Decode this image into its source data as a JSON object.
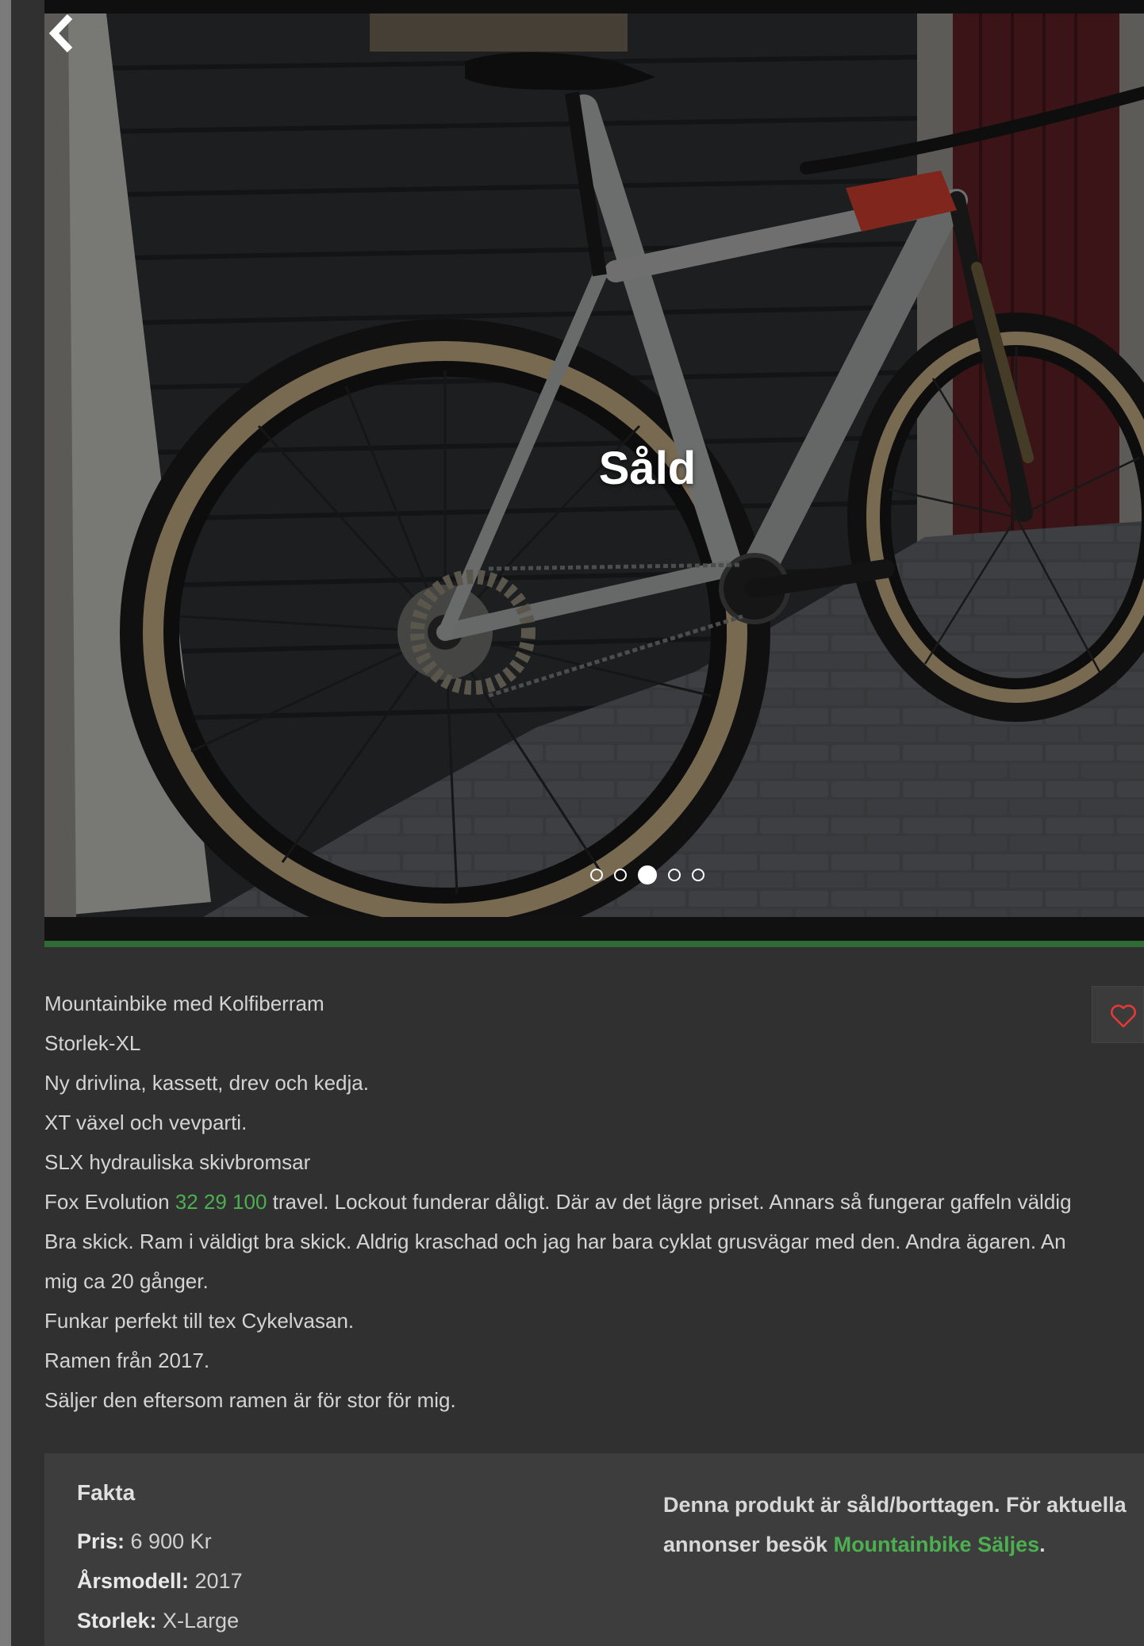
{
  "hero": {
    "overlay_label": "Såld",
    "dots": [
      false,
      false,
      true,
      false,
      false
    ],
    "next_icon": "chevron-right-icon"
  },
  "description": {
    "lines": [
      "Mountainbike med Kolfiberram",
      "Storlek-XL",
      "Ny drivlina, kassett, drev och kedja.",
      "XT växel och vevparti.",
      "SLX hydrauliska skivbromsar"
    ],
    "fox_prefix": "Fox Evolution ",
    "fox_link": "32 29 100",
    "fox_suffix": " travel. Lockout funderar dåligt. Där av det lägre priset. Annars så fungerar gaffeln väldig",
    "lines_after": [
      "Bra skick. Ram i väldigt bra skick. Aldrig kraschad och jag har bara cyklat grusvägar med den. Andra ägaren. An",
      "mig ca 20 gånger.",
      "Funkar perfekt till tex Cykelvasan.",
      "Ramen från 2017.",
      "Säljer den eftersom ramen är för stor för mig."
    ]
  },
  "favorite": {
    "icon": "heart-icon",
    "color": "#e53935"
  },
  "facts": {
    "title": "Fakta",
    "price_label": "Pris:",
    "price_value": " 6 900 Kr",
    "year_label": "Årsmodell:",
    "year_value": " 2017",
    "size_label": "Storlek:",
    "size_value": " X-Large",
    "note_line1": "Denna produkt är såld/borttagen. För aktuella",
    "note_prefix": "annonser besök ",
    "note_link": "Mountainbike Säljes",
    "note_suffix": "."
  },
  "colors": {
    "accent_green": "#4caf50",
    "divider_green": "#2f6b35"
  }
}
